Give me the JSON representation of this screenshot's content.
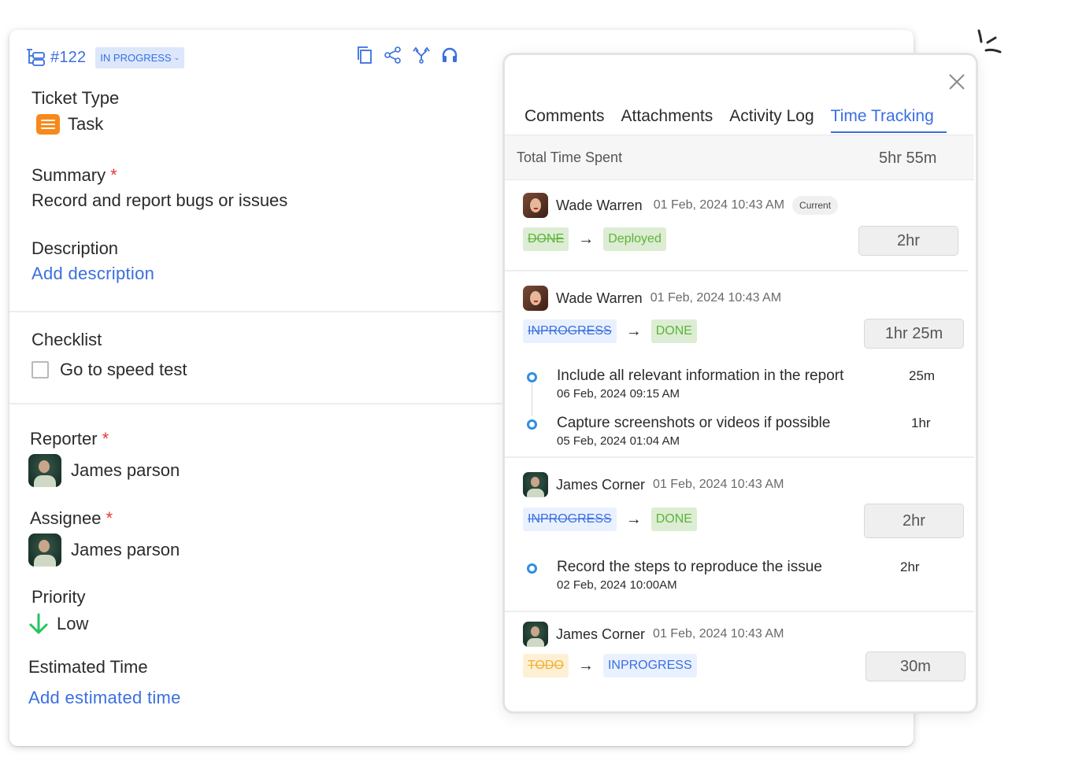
{
  "ticket": {
    "id": "#122",
    "status": "IN PROGRESS",
    "toolbar_icons": [
      "copy-icon",
      "share-icon",
      "branch-icon",
      "headset-icon"
    ]
  },
  "fields": {
    "ticket_type_label": "Ticket Type",
    "ticket_type_value": "Task",
    "summary_label": "Summary",
    "summary_value": "Record and report bugs or issues",
    "description_label": "Description",
    "description_link": "Add description",
    "checklist_label": "Checklist",
    "checklist_items": [
      {
        "label": "Go to speed test",
        "checked": false
      }
    ],
    "reporter_label": "Reporter",
    "reporter_value": "James parson",
    "assignee_label": "Assignee",
    "assignee_value": "James parson",
    "priority_label": "Priority",
    "priority_value": "Low",
    "estimated_label": "Estimated Time",
    "estimated_link": "Add estimated time",
    "required_mark": "*"
  },
  "panel": {
    "tabs": [
      {
        "label": "Comments",
        "active": false
      },
      {
        "label": "Attachments",
        "active": false
      },
      {
        "label": "Activity Log",
        "active": false
      },
      {
        "label": "Time Tracking",
        "active": true
      }
    ],
    "total_label": "Total Time Spent",
    "total_value": "5hr 55m",
    "arrow": "→",
    "entries": [
      {
        "user": "Wade Warren",
        "date": "01 Feb, 2024 10:43 AM",
        "badge": "Current",
        "from": "DONE",
        "to": "Deployed",
        "time": "2hr",
        "subtasks": []
      },
      {
        "user": "Wade Warren",
        "date": "01 Feb, 2024 10:43 AM",
        "from": "INPROGRESS",
        "to": "DONE",
        "time": "1hr 25m",
        "subtasks": [
          {
            "title": "Include all relevant information in the report",
            "date": "06 Feb, 2024 09:15 AM",
            "time": "25m"
          },
          {
            "title": "Capture screenshots or videos if possible",
            "date": "05 Feb, 2024 01:04 AM",
            "time": "1hr"
          }
        ]
      },
      {
        "user": "James Corner",
        "date": "01 Feb, 2024 10:43 AM",
        "from": "INPROGRESS",
        "to": "DONE",
        "time": "2hr",
        "subtasks": [
          {
            "title": "Record the steps to reproduce the issue",
            "date": "02 Feb, 2024 10:00AM",
            "time": "2hr"
          }
        ]
      },
      {
        "user": "James Corner",
        "date": "01 Feb, 2024 10:43 AM",
        "from": "TODO",
        "to": "INPROGRESS",
        "time": "30m",
        "subtasks": []
      }
    ]
  },
  "colors": {
    "accent": "#3a6fe0",
    "required": "#e53935",
    "task": "#f7891b",
    "priority_low": "#22c55e",
    "done_green": "#5db33a",
    "todo_orange": "#f0b132"
  }
}
